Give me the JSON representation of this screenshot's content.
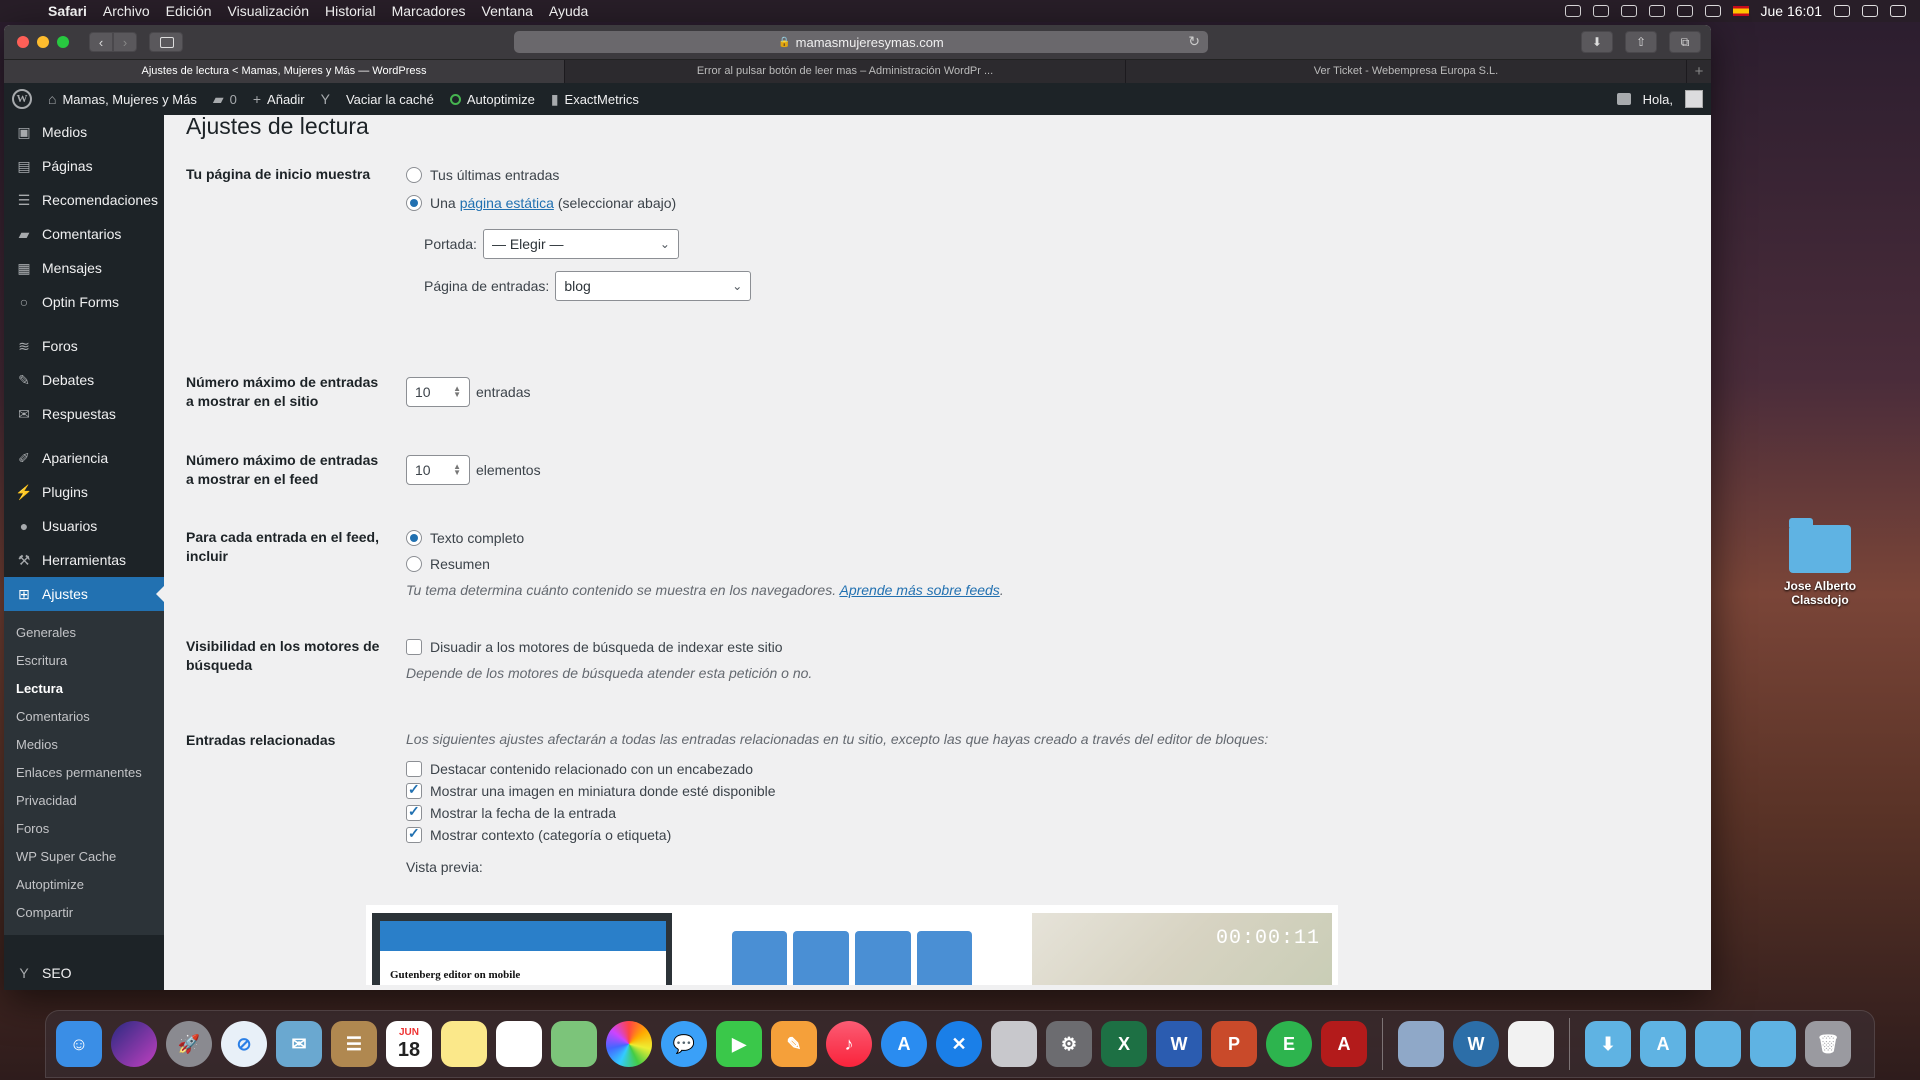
{
  "menubar": {
    "items": [
      "Safari",
      "Archivo",
      "Edición",
      "Visualización",
      "Historial",
      "Marcadores",
      "Ventana",
      "Ayuda"
    ],
    "clock": "Jue 16:01"
  },
  "desktop": {
    "folder_label_1": "Jose Alberto",
    "folder_label_2": "Classdojo"
  },
  "browser": {
    "url": "mamasmujeresymas.com",
    "tabs": [
      "Ajustes de lectura < Mamas, Mujeres y Más — WordPress",
      "Error al pulsar botón de leer mas – Administración WordPr ...",
      "Ver Ticket - Webempresa Europa S.L."
    ]
  },
  "adminbar": {
    "site": "Mamas, Mujeres y Más",
    "comments": "0",
    "add": "Añadir",
    "clear_cache": "Vaciar la caché",
    "autoptimize": "Autoptimize",
    "exactmetrics": "ExactMetrics",
    "greeting": "Hola,"
  },
  "menu": {
    "items": [
      {
        "label": "Medios",
        "icon": "media-icon"
      },
      {
        "label": "Páginas",
        "icon": "pages-icon"
      },
      {
        "label": "Recomendaciones",
        "icon": "recommendations-icon"
      },
      {
        "label": "Comentarios",
        "icon": "comments-icon"
      },
      {
        "label": "Mensajes",
        "icon": "messages-icon"
      },
      {
        "label": "Optin Forms",
        "icon": "optin-icon"
      },
      {
        "label": "Foros",
        "icon": "forums-icon"
      },
      {
        "label": "Debates",
        "icon": "topics-icon"
      },
      {
        "label": "Respuestas",
        "icon": "replies-icon"
      },
      {
        "label": "Apariencia",
        "icon": "appearance-icon"
      },
      {
        "label": "Plugins",
        "icon": "plugins-icon"
      },
      {
        "label": "Usuarios",
        "icon": "users-icon"
      },
      {
        "label": "Herramientas",
        "icon": "tools-icon"
      },
      {
        "label": "Ajustes",
        "icon": "settings-icon"
      }
    ],
    "sub": [
      "Generales",
      "Escritura",
      "Lectura",
      "Comentarios",
      "Medios",
      "Enlaces permanentes",
      "Privacidad",
      "Foros",
      "WP Super Cache",
      "Autoptimize",
      "Compartir"
    ],
    "seo": "SEO"
  },
  "page": {
    "title": "Ajustes de lectura",
    "home_label": "Tu página de inicio muestra",
    "home_opt1": "Tus últimas entradas",
    "home_opt2_pre": "Una",
    "home_opt2_link": "página estática",
    "home_opt2_post": "(seleccionar abajo)",
    "front_label": "Portada:",
    "front_value": "— Elegir —",
    "posts_label": "Página de entradas:",
    "posts_value": "blog",
    "max_site_label_1": "Número máximo de entradas",
    "max_site_label_2": "a mostrar en el sitio",
    "max_site_value": "10",
    "max_site_unit": "entradas",
    "max_feed_label_1": "Número máximo de entradas",
    "max_feed_label_2": "a mostrar en el feed",
    "max_feed_value": "10",
    "max_feed_unit": "elementos",
    "feed_label_1": "Para cada entrada en el feed,",
    "feed_label_2": "incluir",
    "feed_opt1": "Texto completo",
    "feed_opt2": "Resumen",
    "feed_desc": "Tu tema determina cuánto contenido se muestra en los navegadores.",
    "feed_desc_link": "Aprende más sobre feeds",
    "vis_label_1": "Visibilidad en los motores de",
    "vis_label_2": "búsqueda",
    "vis_opt": "Disuadir a los motores de búsqueda de indexar este sitio",
    "vis_desc": "Depende de los motores de búsqueda atender esta petición o no.",
    "rel_label": "Entradas relacionadas",
    "rel_desc": "Los siguientes ajustes afectarán a todas las entradas relacionadas en tu sitio, excepto las que hayas creado a través del editor de bloques:",
    "rel_opt1": "Destacar contenido relacionado con un encabezado",
    "rel_opt2": "Mostrar una imagen en miniatura donde esté disponible",
    "rel_opt3": "Mostrar la fecha de la entrada",
    "rel_opt4": "Mostrar contexto (categoría o etiqueta)",
    "preview_label": "Vista previa:",
    "preview_card_title": "Gutenberg editor on mobile",
    "preview_time": "00:00:11"
  },
  "dock": {
    "calendar_month": "JUN",
    "calendar_day": "18"
  }
}
